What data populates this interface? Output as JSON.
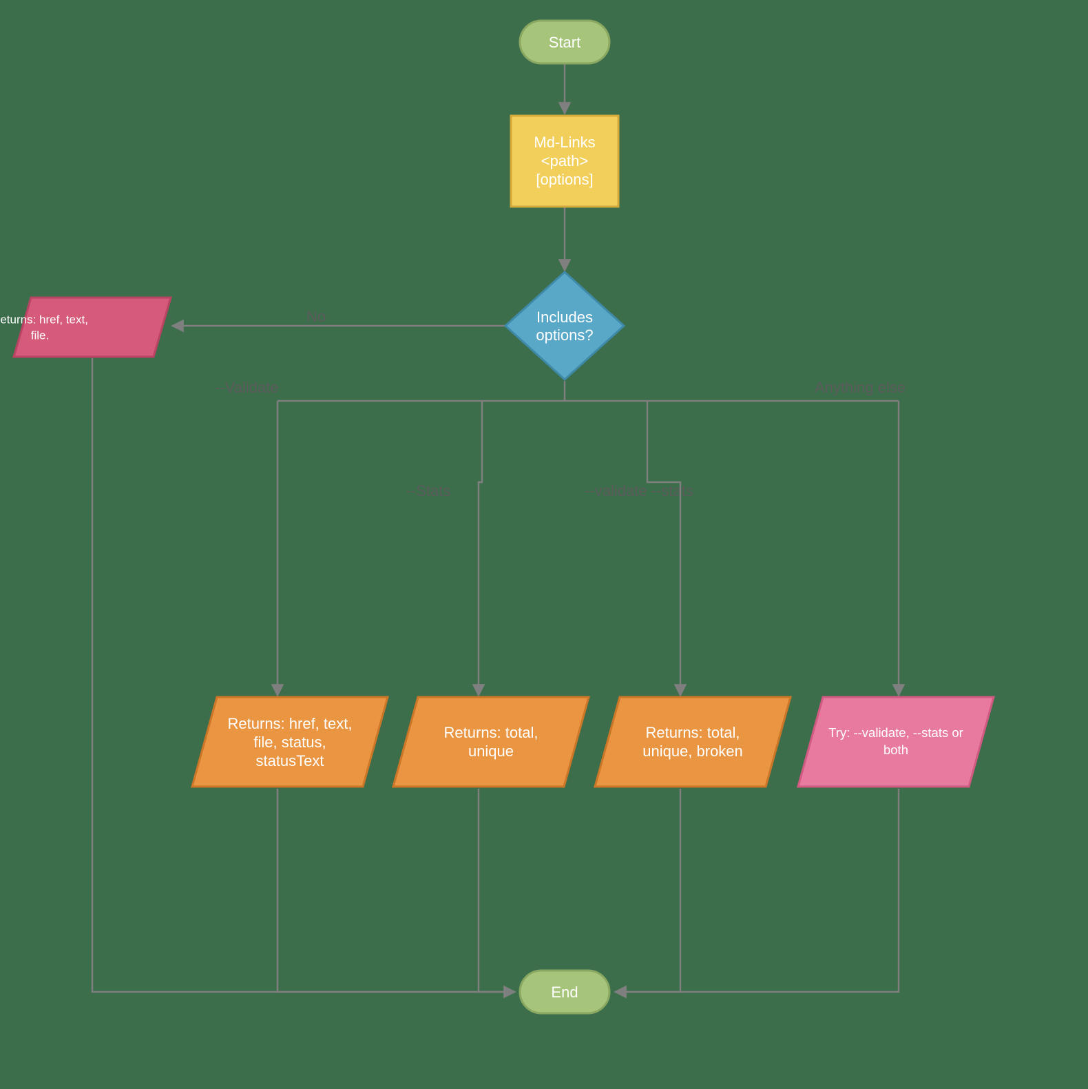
{
  "nodes": {
    "start": "Start",
    "process_l1": "Md-Links",
    "process_l2": "<path>",
    "process_l3": "[options]",
    "decision_l1": "Includes",
    "decision_l2": "options?",
    "no_result_l1": "Returns: href, text,",
    "no_result_l2": "file.",
    "validate_result_l1": "Returns: href, text,",
    "validate_result_l2": "file, status,",
    "validate_result_l3": "statusText",
    "stats_result_l1": "Returns: total,",
    "stats_result_l2": "unique",
    "both_result_l1": "Returns: total,",
    "both_result_l2": "unique, broken",
    "else_result_l1": "Try: --validate, --stats or",
    "else_result_l2": "both",
    "end": "End"
  },
  "edges": {
    "no": "No",
    "validate": "--Validate",
    "stats": "--Stats",
    "both": "--validate --stats",
    "else": "Anything else"
  },
  "colors": {
    "bg": "#3c6e4b",
    "terminator_fill": "#a6c47a",
    "terminator_stroke": "#8aa861",
    "process_fill": "#f2cf5b",
    "process_stroke": "#d4a93b",
    "decision_fill": "#5aa8c8",
    "decision_stroke": "#3f8aa8",
    "io_orange_fill": "#e99541",
    "io_orange_stroke": "#cc7628",
    "io_pink_fill": "#e87a9f",
    "io_pink_stroke": "#d15a82",
    "io_darkpink_fill": "#d65a7a",
    "io_darkpink_stroke": "#b84362",
    "edge": "#7f7f7f"
  }
}
